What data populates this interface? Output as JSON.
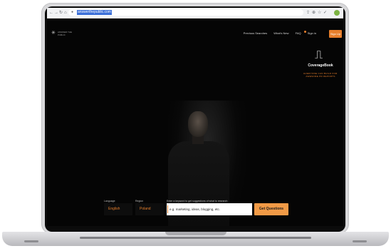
{
  "browser": {
    "url": "answerthepublic.com",
    "back_icon": "arrow-left-icon",
    "forward_icon": "arrow-right-icon",
    "reload_icon": "reload-icon",
    "home_icon": "home-icon"
  },
  "nav": {
    "logo_text": "ANSWER THE PUBLIC",
    "items": [
      "Previous Searches",
      "What's New",
      "FAQ",
      "Sign in"
    ],
    "signup_label": "Sign Up",
    "accent_color": "#e77f2c"
  },
  "badge": {
    "name": "CoverageBook",
    "tagline": "EVERYONE CAN BUILD FOR AWESOME PR REPORTS"
  },
  "form": {
    "language_label": "Language",
    "language_value": "English",
    "region_label": "Region",
    "region_value": "Poland",
    "query_label": "Enter a keyword to get suggestions of what to research",
    "query_value": "e.g. marketing, ideas, blogging, etc.",
    "submit_label": "Get Questions"
  }
}
